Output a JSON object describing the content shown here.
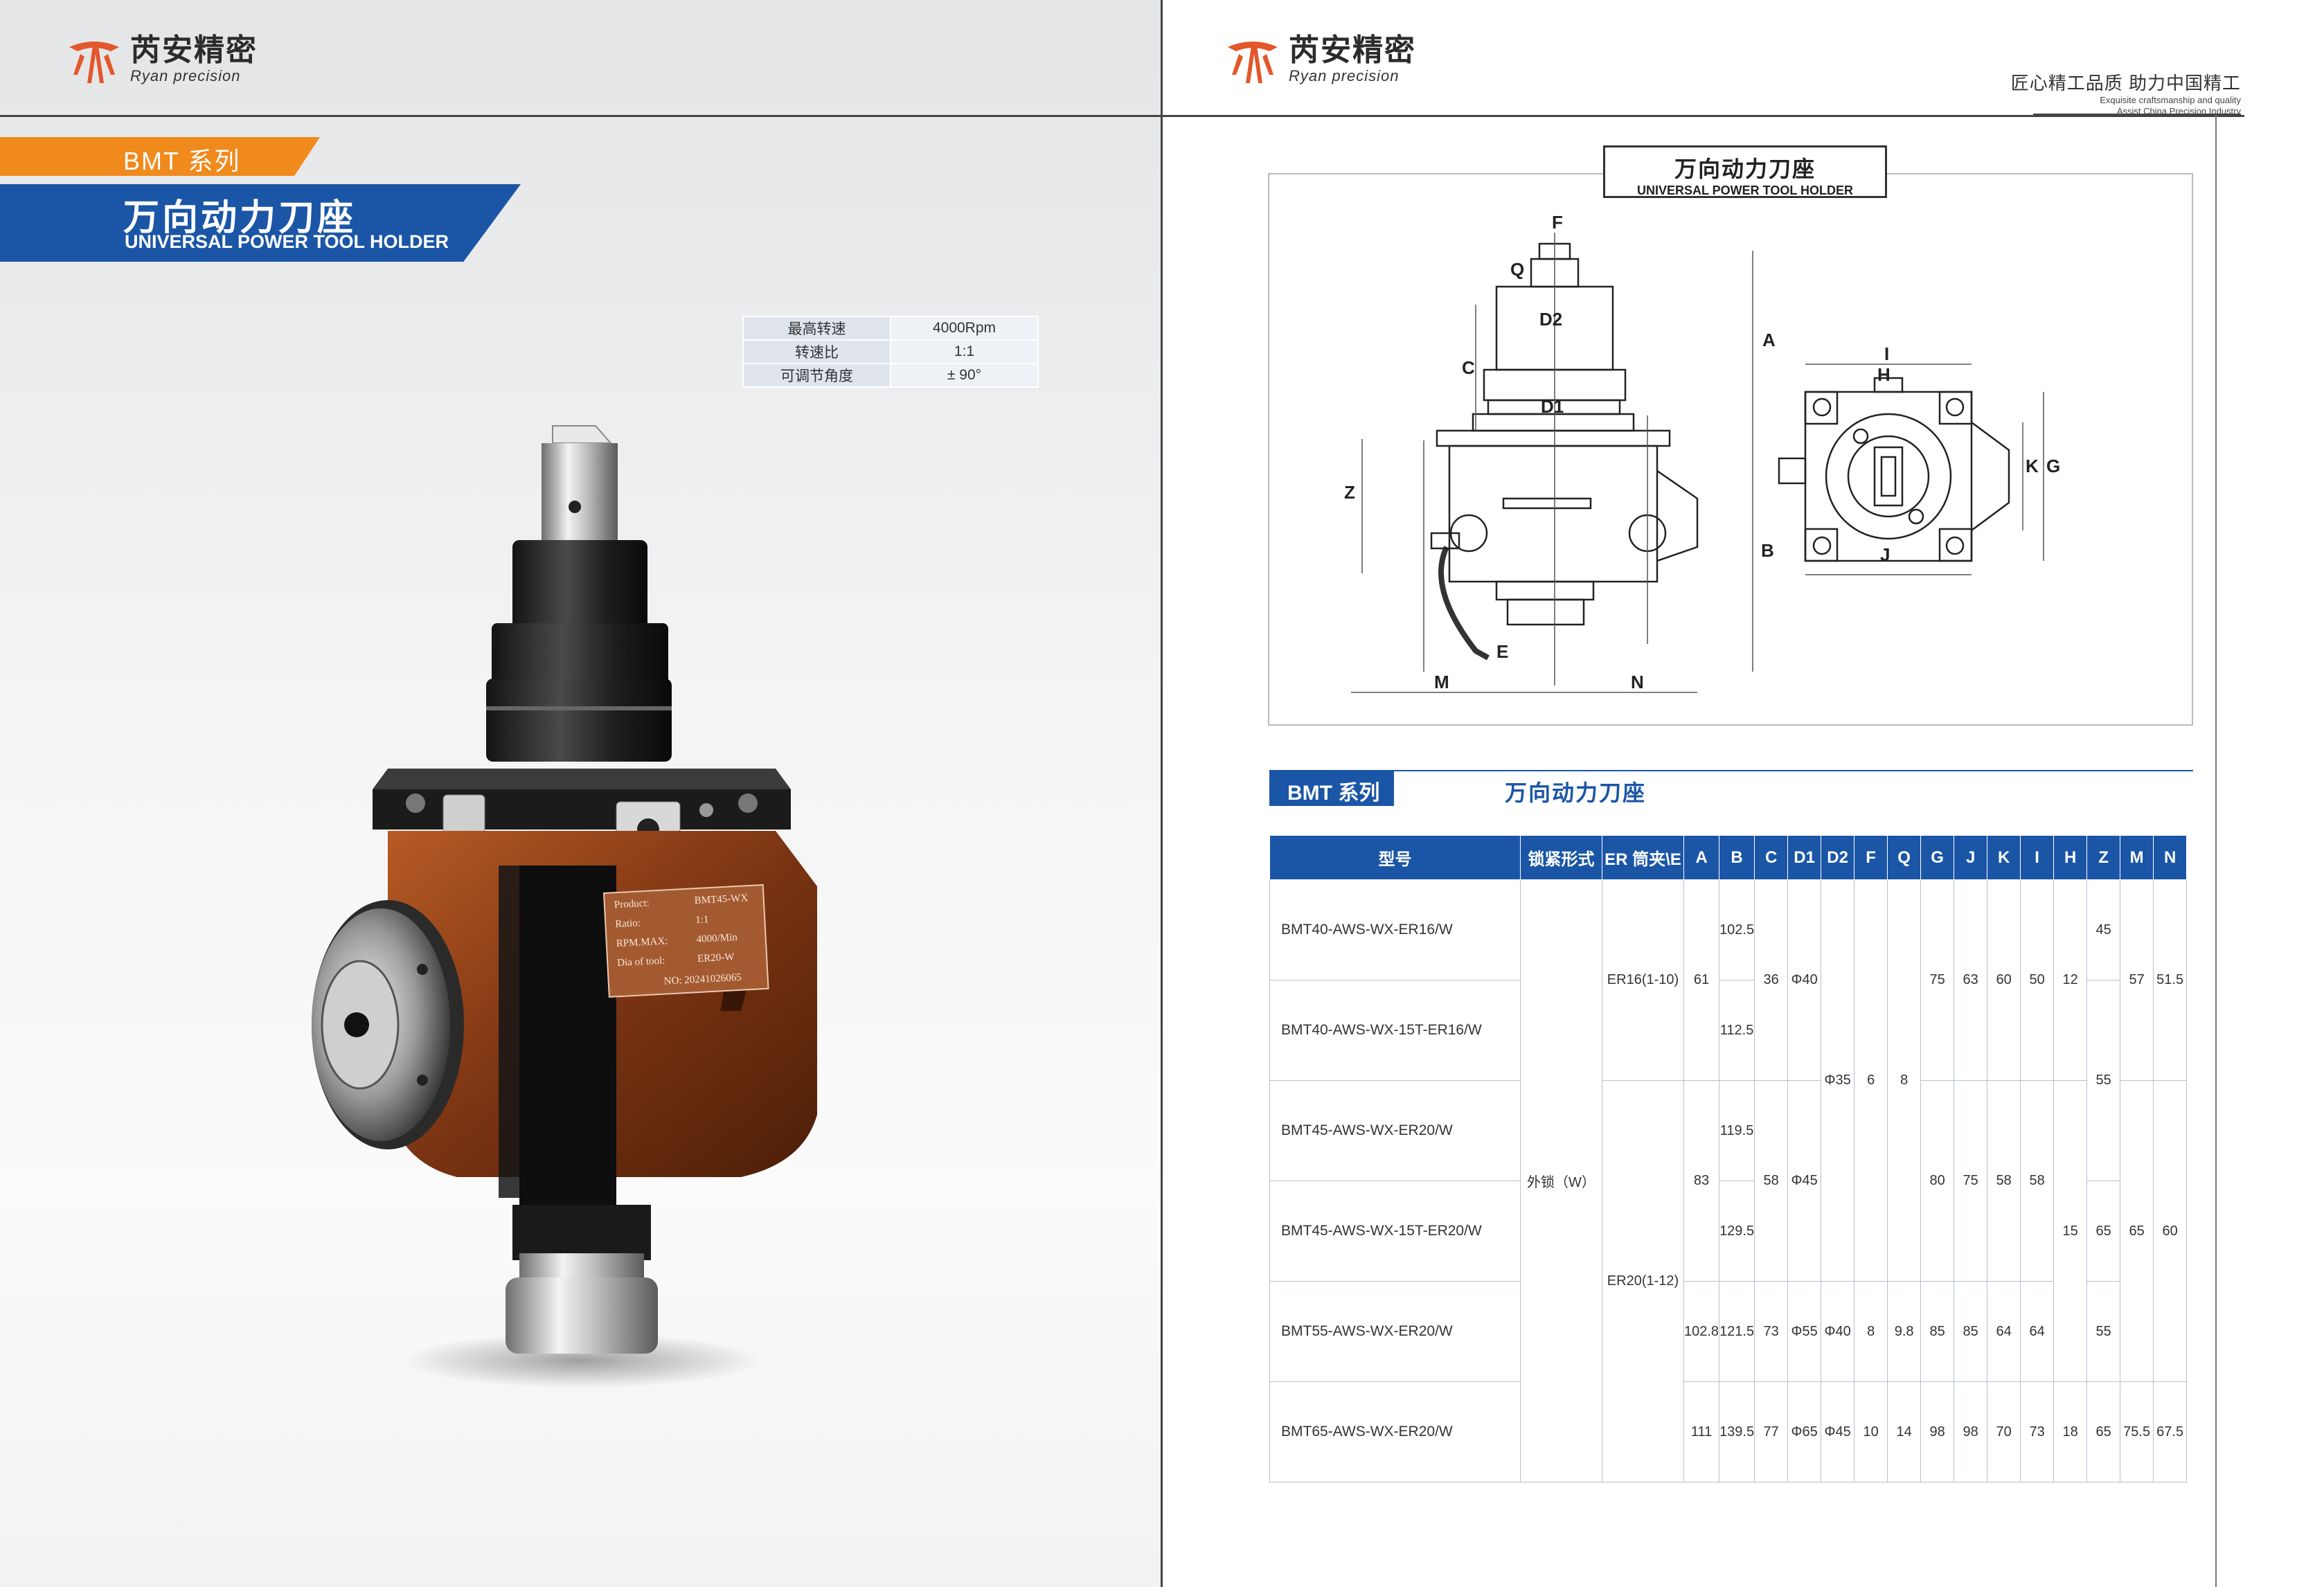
{
  "brand": {
    "name_cn": "芮安精密",
    "name_en": "Ryan precision"
  },
  "left": {
    "series_tag": "BMT 系列",
    "title_cn": "万向动力刀座",
    "title_en": "UNIVERSAL POWER TOOL HOLDER",
    "specs": [
      {
        "label": "最高转速",
        "value": "4000Rpm"
      },
      {
        "label": "转速比",
        "value": "1:1"
      },
      {
        "label": "可调节角度",
        "value": "± 90°"
      }
    ],
    "nameplate": {
      "rows": [
        {
          "k": "Product:",
          "v": "BMT45-WX"
        },
        {
          "k": "Ratio:",
          "v": "1:1"
        },
        {
          "k": "RPM.MAX:",
          "v": "4000/Min"
        },
        {
          "k": "Dia of tool:",
          "v": "ER20-W"
        }
      ],
      "serial": "NO: 20241026065"
    },
    "colors": {
      "orange": "#f08a1c",
      "blue": "#1b56a6",
      "body": "#8a3d17"
    }
  },
  "right": {
    "slogan_cn": "匠心精工品质  助力中国精工",
    "slogan_en_1": "Exquisite craftsmanship and quality",
    "slogan_en_2": "Assist   China   Precision   Industry",
    "drawing_title_cn": "万向动力刀座",
    "drawing_title_en": "UNIVERSAL POWER TOOL HOLDER",
    "dims": [
      "F",
      "Q",
      "D2",
      "C",
      "A",
      "D1",
      "Z",
      "B",
      "E",
      "M",
      "N",
      "I",
      "H",
      "K",
      "G",
      "J"
    ],
    "section_tag": "BMT 系列",
    "section_title": "万向动力刀座",
    "table": {
      "headers": [
        "型号",
        "锁紧形式",
        "ER 筒夹\\E",
        "A",
        "B",
        "C",
        "D1",
        "D2",
        "F",
        "Q",
        "G",
        "J",
        "K",
        "I",
        "H",
        "Z",
        "M",
        "N"
      ],
      "models": [
        "BMT40-AWS-WX-ER16/W",
        "BMT40-AWS-WX-15T-ER16/W",
        "BMT45-AWS-WX-ER20/W",
        "BMT45-AWS-WX-15T-ER20/W",
        "BMT55-AWS-WX-ER20/W",
        "BMT65-AWS-WX-ER20/W"
      ],
      "lock": "外锁（W）",
      "er16": "ER16(1-10)",
      "er20": "ER20(1-12)",
      "B": [
        "102.5",
        "112.5",
        "119.5",
        "129.5",
        "121.5",
        "139.5"
      ],
      "g1": {
        "A": "61",
        "C": "36",
        "D1": "Φ40",
        "G": "75",
        "J": "63",
        "K": "60",
        "I": "50",
        "H": "12",
        "M": "57",
        "N": "51.5"
      },
      "g2": {
        "A": "83",
        "C": "58",
        "D1": "Φ45",
        "G": "80",
        "J": "75",
        "K": "58",
        "I": "58"
      },
      "mid": {
        "D2": "Φ35",
        "F": "6",
        "Q": "8"
      },
      "H2": "15",
      "M2": "65",
      "N2": "60",
      "Z": [
        "45",
        "55",
        "65",
        "55",
        "65"
      ],
      "r5": {
        "A": "102.8",
        "C": "73",
        "D1": "Φ55",
        "D2": "Φ40",
        "F": "8",
        "Q": "9.8",
        "G": "85",
        "J": "85",
        "K": "64",
        "I": "64"
      },
      "r6": {
        "A": "111",
        "C": "77",
        "D1": "Φ65",
        "D2": "Φ45",
        "F": "10",
        "Q": "14",
        "G": "98",
        "J": "98",
        "K": "70",
        "I": "73",
        "H": "18",
        "M": "75.5",
        "N": "67.5"
      }
    }
  }
}
